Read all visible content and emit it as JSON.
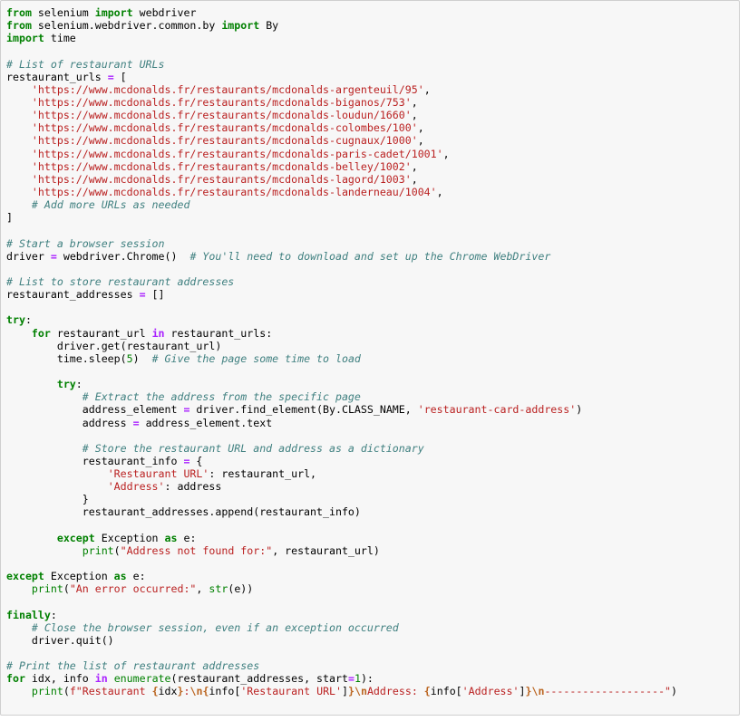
{
  "cell": {
    "lines": [
      [
        [
          "kw",
          "from"
        ],
        [
          "plain",
          " selenium "
        ],
        [
          "kw",
          "import"
        ],
        [
          "plain",
          " webdriver"
        ]
      ],
      [
        [
          "kw",
          "from"
        ],
        [
          "plain",
          " selenium.webdriver.common.by "
        ],
        [
          "kw",
          "import"
        ],
        [
          "plain",
          " By"
        ]
      ],
      [
        [
          "kw",
          "import"
        ],
        [
          "plain",
          " time"
        ]
      ],
      [],
      [
        [
          "cm",
          "# List of restaurant URLs"
        ]
      ],
      [
        [
          "plain",
          "restaurant_urls "
        ],
        [
          "op",
          "="
        ],
        [
          "plain",
          " ["
        ]
      ],
      [
        [
          "plain",
          "    "
        ],
        [
          "str",
          "'https://www.mcdonalds.fr/restaurants/mcdonalds-argenteuil/95'"
        ],
        [
          "plain",
          ","
        ]
      ],
      [
        [
          "plain",
          "    "
        ],
        [
          "str",
          "'https://www.mcdonalds.fr/restaurants/mcdonalds-biganos/753'"
        ],
        [
          "plain",
          ","
        ]
      ],
      [
        [
          "plain",
          "    "
        ],
        [
          "str",
          "'https://www.mcdonalds.fr/restaurants/mcdonalds-loudun/1660'"
        ],
        [
          "plain",
          ","
        ]
      ],
      [
        [
          "plain",
          "    "
        ],
        [
          "str",
          "'https://www.mcdonalds.fr/restaurants/mcdonalds-colombes/100'"
        ],
        [
          "plain",
          ","
        ]
      ],
      [
        [
          "plain",
          "    "
        ],
        [
          "str",
          "'https://www.mcdonalds.fr/restaurants/mcdonalds-cugnaux/1000'"
        ],
        [
          "plain",
          ","
        ]
      ],
      [
        [
          "plain",
          "    "
        ],
        [
          "str",
          "'https://www.mcdonalds.fr/restaurants/mcdonalds-paris-cadet/1001'"
        ],
        [
          "plain",
          ","
        ]
      ],
      [
        [
          "plain",
          "    "
        ],
        [
          "str",
          "'https://www.mcdonalds.fr/restaurants/mcdonalds-belley/1002'"
        ],
        [
          "plain",
          ","
        ]
      ],
      [
        [
          "plain",
          "    "
        ],
        [
          "str",
          "'https://www.mcdonalds.fr/restaurants/mcdonalds-lagord/1003'"
        ],
        [
          "plain",
          ","
        ]
      ],
      [
        [
          "plain",
          "    "
        ],
        [
          "str",
          "'https://www.mcdonalds.fr/restaurants/mcdonalds-landerneau/1004'"
        ],
        [
          "plain",
          ","
        ]
      ],
      [
        [
          "plain",
          "    "
        ],
        [
          "cm",
          "# Add more URLs as needed"
        ]
      ],
      [
        [
          "plain",
          "]"
        ]
      ],
      [],
      [
        [
          "cm",
          "# Start a browser session"
        ]
      ],
      [
        [
          "plain",
          "driver "
        ],
        [
          "op",
          "="
        ],
        [
          "plain",
          " webdriver.Chrome()  "
        ],
        [
          "cm",
          "# You'll need to download and set up the Chrome WebDriver"
        ]
      ],
      [],
      [
        [
          "cm",
          "# List to store restaurant addresses"
        ]
      ],
      [
        [
          "plain",
          "restaurant_addresses "
        ],
        [
          "op",
          "="
        ],
        [
          "plain",
          " []"
        ]
      ],
      [],
      [
        [
          "kw",
          "try"
        ],
        [
          "plain",
          ":"
        ]
      ],
      [
        [
          "plain",
          "    "
        ],
        [
          "kw",
          "for"
        ],
        [
          "plain",
          " restaurant_url "
        ],
        [
          "op",
          "in"
        ],
        [
          "plain",
          " restaurant_urls:"
        ]
      ],
      [
        [
          "plain",
          "        driver.get(restaurant_url)"
        ]
      ],
      [
        [
          "plain",
          "        time.sleep("
        ],
        [
          "num",
          "5"
        ],
        [
          "plain",
          ")  "
        ],
        [
          "cm",
          "# Give the page some time to load"
        ]
      ],
      [],
      [
        [
          "plain",
          "        "
        ],
        [
          "kw",
          "try"
        ],
        [
          "plain",
          ":"
        ]
      ],
      [
        [
          "plain",
          "            "
        ],
        [
          "cm",
          "# Extract the address from the specific page"
        ]
      ],
      [
        [
          "plain",
          "            address_element "
        ],
        [
          "op",
          "="
        ],
        [
          "plain",
          " driver.find_element(By.CLASS_NAME, "
        ],
        [
          "str",
          "'restaurant-card-address'"
        ],
        [
          "plain",
          ")"
        ]
      ],
      [
        [
          "plain",
          "            address "
        ],
        [
          "op",
          "="
        ],
        [
          "plain",
          " address_element.text"
        ]
      ],
      [],
      [
        [
          "plain",
          "            "
        ],
        [
          "cm",
          "# Store the restaurant URL and address as a dictionary"
        ]
      ],
      [
        [
          "plain",
          "            restaurant_info "
        ],
        [
          "op",
          "="
        ],
        [
          "plain",
          " {"
        ]
      ],
      [
        [
          "plain",
          "                "
        ],
        [
          "str",
          "'Restaurant URL'"
        ],
        [
          "plain",
          ": restaurant_url,"
        ]
      ],
      [
        [
          "plain",
          "                "
        ],
        [
          "str",
          "'Address'"
        ],
        [
          "plain",
          ": address"
        ]
      ],
      [
        [
          "plain",
          "            }"
        ]
      ],
      [
        [
          "plain",
          "            restaurant_addresses.append(restaurant_info)"
        ]
      ],
      [],
      [
        [
          "plain",
          "        "
        ],
        [
          "kw",
          "except"
        ],
        [
          "plain",
          " Exception "
        ],
        [
          "kw",
          "as"
        ],
        [
          "plain",
          " e:"
        ]
      ],
      [
        [
          "plain",
          "            "
        ],
        [
          "bi",
          "print"
        ],
        [
          "plain",
          "("
        ],
        [
          "str",
          "\"Address not found for:\""
        ],
        [
          "plain",
          ", restaurant_url)"
        ]
      ],
      [],
      [
        [
          "kw",
          "except"
        ],
        [
          "plain",
          " Exception "
        ],
        [
          "kw",
          "as"
        ],
        [
          "plain",
          " e:"
        ]
      ],
      [
        [
          "plain",
          "    "
        ],
        [
          "bi",
          "print"
        ],
        [
          "plain",
          "("
        ],
        [
          "str",
          "\"An error occurred:\""
        ],
        [
          "plain",
          ", "
        ],
        [
          "bi",
          "str"
        ],
        [
          "plain",
          "(e))"
        ]
      ],
      [],
      [
        [
          "kw",
          "finally"
        ],
        [
          "plain",
          ":"
        ]
      ],
      [
        [
          "plain",
          "    "
        ],
        [
          "cm",
          "# Close the browser session, even if an exception occurred"
        ]
      ],
      [
        [
          "plain",
          "    driver.quit()"
        ]
      ],
      [],
      [
        [
          "cm",
          "# Print the list of restaurant addresses"
        ]
      ],
      [
        [
          "kw",
          "for"
        ],
        [
          "plain",
          " idx, info "
        ],
        [
          "op",
          "in"
        ],
        [
          "plain",
          " "
        ],
        [
          "bi",
          "enumerate"
        ],
        [
          "plain",
          "(restaurant_addresses, start"
        ],
        [
          "op",
          "="
        ],
        [
          "num",
          "1"
        ],
        [
          "plain",
          "):"
        ]
      ],
      [
        [
          "plain",
          "    "
        ],
        [
          "bi",
          "print"
        ],
        [
          "plain",
          "("
        ],
        [
          "str",
          "f\"Restaurant "
        ],
        [
          "esc",
          "{"
        ],
        [
          "plain",
          "idx"
        ],
        [
          "esc",
          "}"
        ],
        [
          "str",
          ":"
        ],
        [
          "esc",
          "\\n"
        ],
        [
          "esc",
          "{"
        ],
        [
          "plain",
          "info["
        ],
        [
          "str",
          "'Restaurant URL'"
        ],
        [
          "plain",
          "]"
        ],
        [
          "esc",
          "}"
        ],
        [
          "esc",
          "\\n"
        ],
        [
          "str",
          "Address: "
        ],
        [
          "esc",
          "{"
        ],
        [
          "plain",
          "info["
        ],
        [
          "str",
          "'Address'"
        ],
        [
          "plain",
          "]"
        ],
        [
          "esc",
          "}"
        ],
        [
          "esc",
          "\\n"
        ],
        [
          "str",
          "-------------------\""
        ],
        [
          "plain",
          ")"
        ]
      ]
    ]
  }
}
